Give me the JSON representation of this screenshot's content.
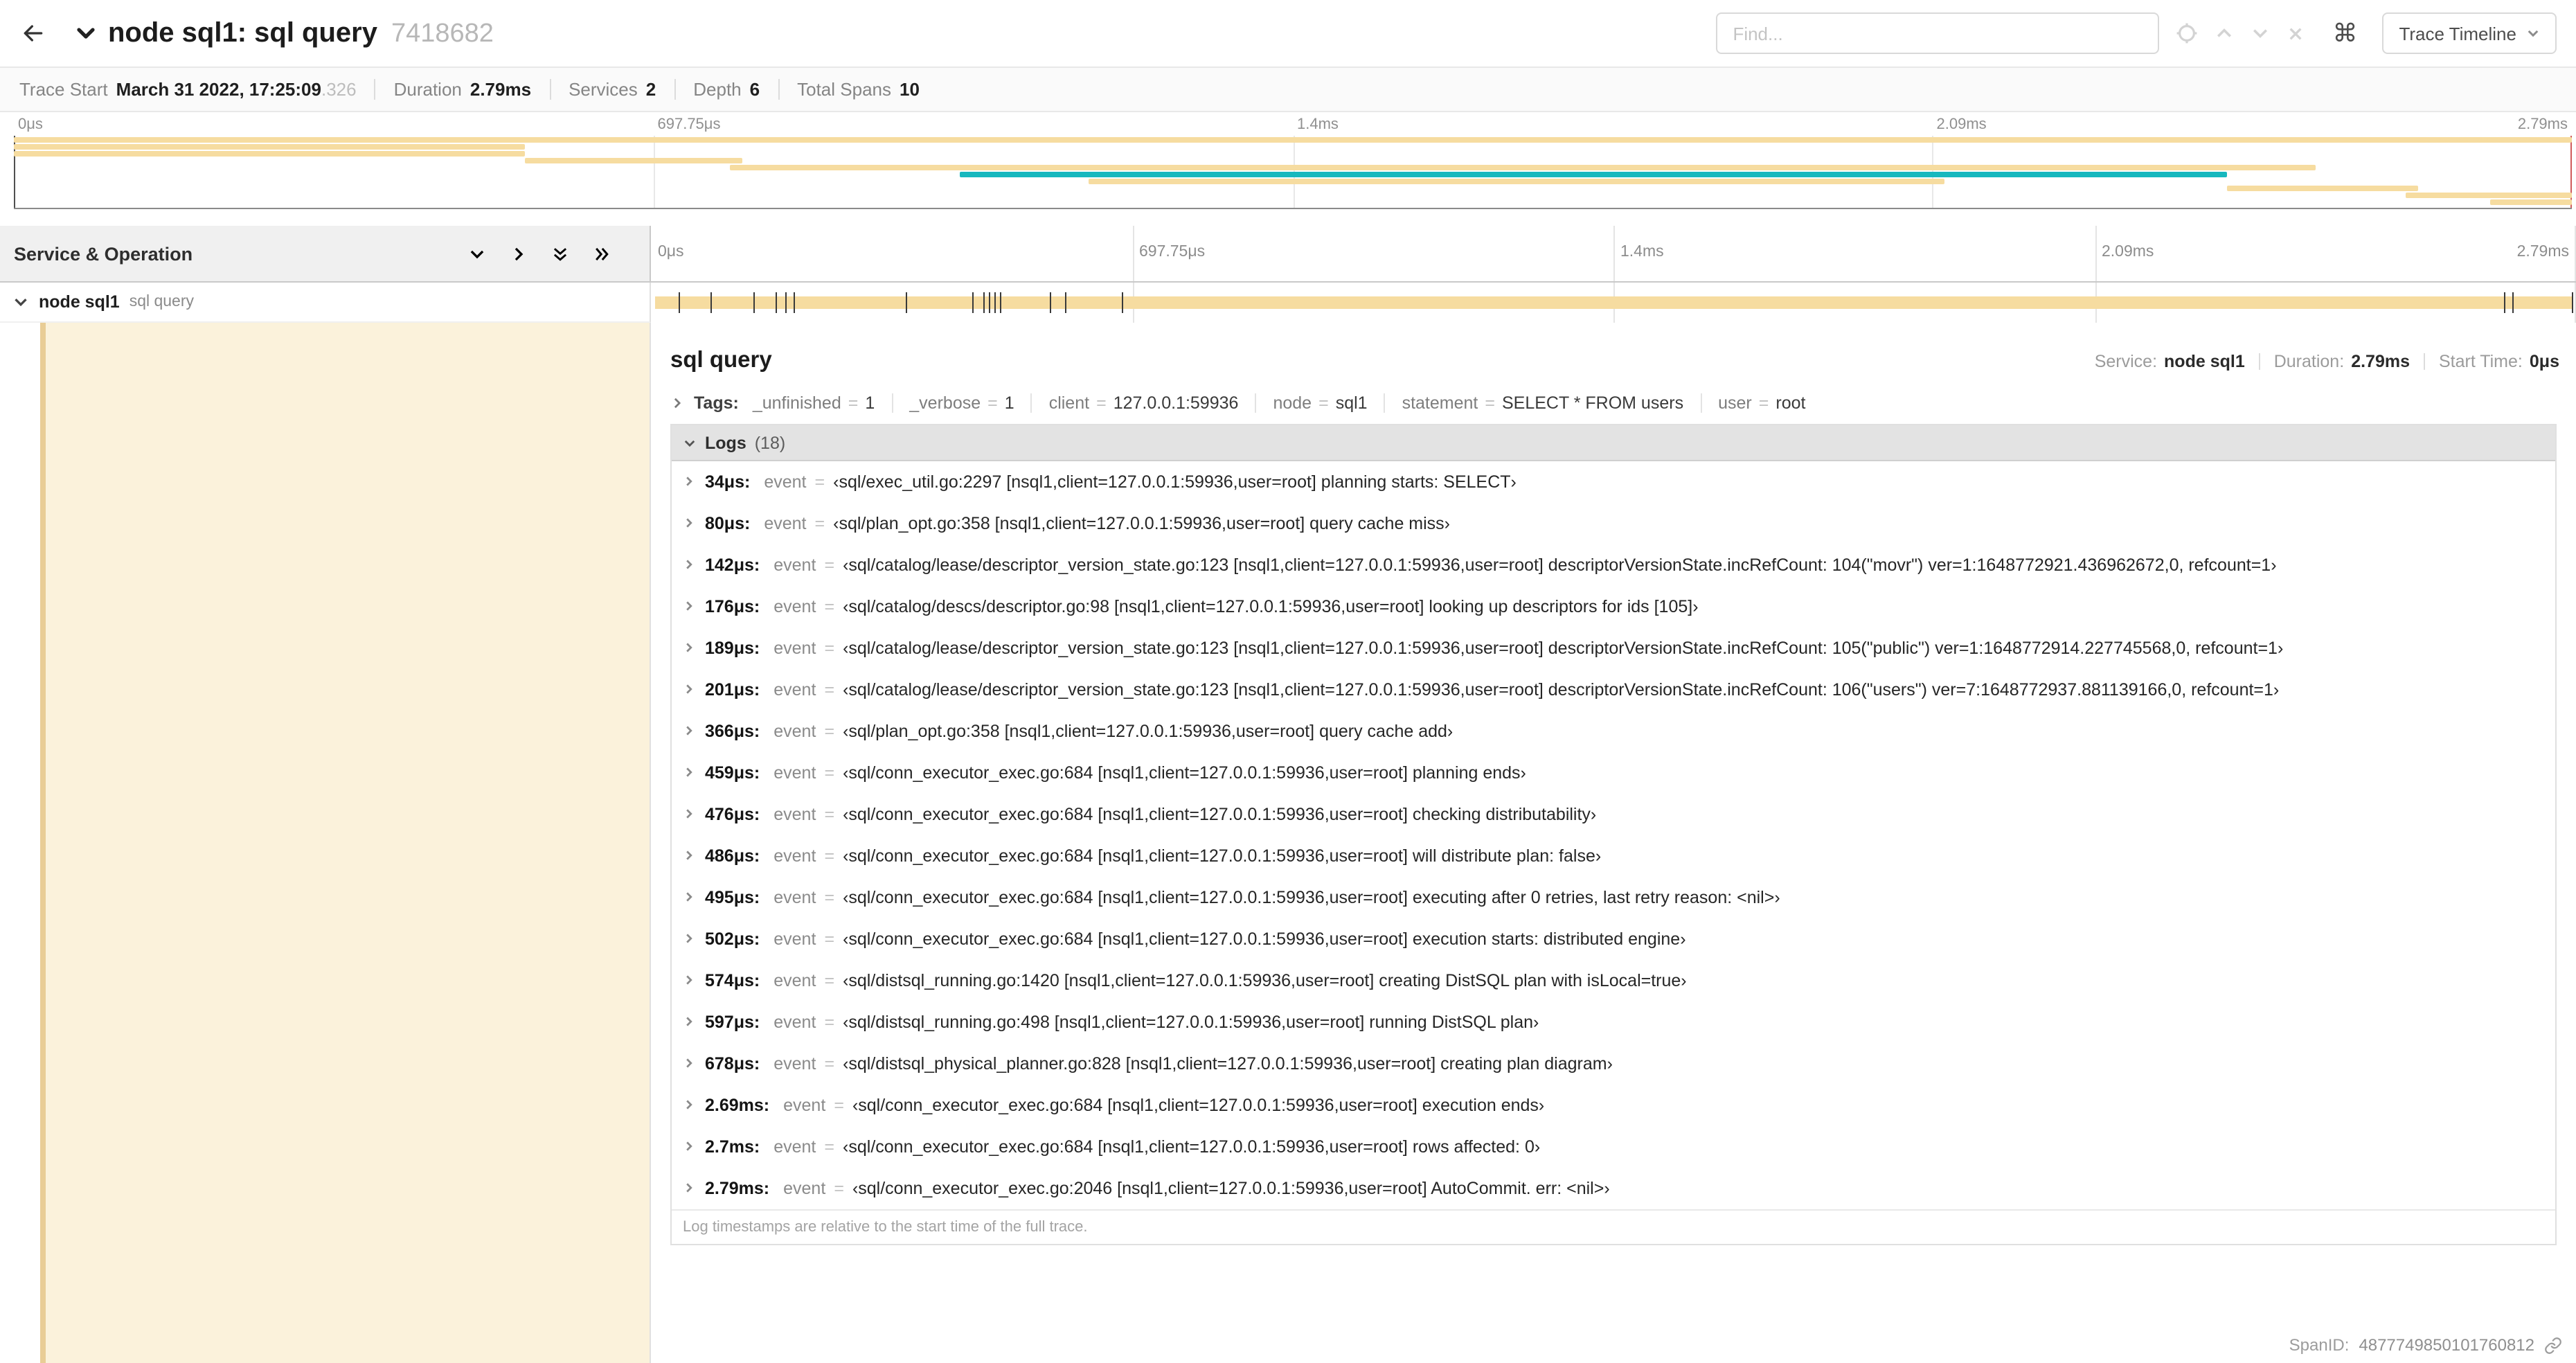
{
  "header": {
    "title": "node sql1: sql query",
    "trace_id": "7418682",
    "find_placeholder": "Find...",
    "shortcut_icon": "⌘",
    "view_button": "Trace Timeline"
  },
  "summary": {
    "items": [
      {
        "label": "Trace Start",
        "value": "March 31 2022, 17:25:09",
        "suffix": ".326"
      },
      {
        "label": "Duration",
        "value": "2.79ms"
      },
      {
        "label": "Services",
        "value": "2"
      },
      {
        "label": "Depth",
        "value": "6"
      },
      {
        "label": "Total Spans",
        "value": "10"
      }
    ]
  },
  "timeline": {
    "ticks": [
      {
        "label": "0μs",
        "pos": 0
      },
      {
        "label": "697.75μs",
        "pos": 25
      },
      {
        "label": "1.4ms",
        "pos": 50
      },
      {
        "label": "2.09ms",
        "pos": 75
      },
      {
        "label": "2.79ms",
        "pos": 100
      }
    ]
  },
  "minimap": {
    "colors": {
      "tan": "#F6DCA0",
      "teal": "#17B8BE"
    },
    "spans": [
      {
        "start": 0.0,
        "end": 1.0,
        "row": 0,
        "color": "tan"
      },
      {
        "start": 0.0,
        "end": 0.2,
        "row": 1,
        "color": "tan"
      },
      {
        "start": 0.0,
        "end": 0.2,
        "row": 2,
        "color": "tan"
      },
      {
        "start": 0.2,
        "end": 0.285,
        "row": 3,
        "color": "tan"
      },
      {
        "start": 0.28,
        "end": 0.9,
        "row": 4,
        "color": "tan"
      },
      {
        "start": 0.37,
        "end": 0.865,
        "row": 5,
        "color": "teal"
      },
      {
        "start": 0.42,
        "end": 0.755,
        "row": 6,
        "color": "tan"
      },
      {
        "start": 0.865,
        "end": 0.94,
        "row": 7,
        "color": "tan"
      },
      {
        "start": 0.935,
        "end": 1.0,
        "row": 8,
        "color": "tan"
      },
      {
        "start": 0.968,
        "end": 1.0,
        "row": 9,
        "color": "tan"
      }
    ]
  },
  "span_list": {
    "header": "Service & Operation",
    "row": {
      "service": "node sql1",
      "operation": "sql query"
    },
    "tick_fractions": [
      1.2,
      2.9,
      5.1,
      6.3,
      6.8,
      7.2,
      13.1,
      16.5,
      17.1,
      17.4,
      17.7,
      18.0,
      20.6,
      21.4,
      24.3,
      96.4,
      96.8,
      99.9
    ]
  },
  "detail": {
    "title": "sql query",
    "eq": "=",
    "meta": [
      {
        "label": "Service:",
        "value": "node sql1"
      },
      {
        "label": "Duration:",
        "value": "2.79ms"
      },
      {
        "label": "Start Time:",
        "value": "0μs"
      }
    ],
    "tags_label": "Tags:",
    "tags": [
      {
        "k": "_unfinished",
        "v": "1"
      },
      {
        "k": "_verbose",
        "v": "1"
      },
      {
        "k": "client",
        "v": "127.0.0.1:59936"
      },
      {
        "k": "node",
        "v": "sql1"
      },
      {
        "k": "statement",
        "v": "SELECT * FROM users"
      },
      {
        "k": "user",
        "v": "root"
      }
    ],
    "logs_label": "Logs",
    "logs_count": "(18)",
    "logs": [
      {
        "t": "34μs:",
        "k": "event",
        "v": "‹sql/exec_util.go:2297 [nsql1,client=127.0.0.1:59936,user=root] planning starts: SELECT›"
      },
      {
        "t": "80μs:",
        "k": "event",
        "v": "‹sql/plan_opt.go:358 [nsql1,client=127.0.0.1:59936,user=root] query cache miss›"
      },
      {
        "t": "142μs:",
        "k": "event",
        "v": "‹sql/catalog/lease/descriptor_version_state.go:123 [nsql1,client=127.0.0.1:59936,user=root] descriptorVersionState.incRefCount: 104(\"movr\") ver=1:1648772921.436962672,0, refcount=1›"
      },
      {
        "t": "176μs:",
        "k": "event",
        "v": "‹sql/catalog/descs/descriptor.go:98 [nsql1,client=127.0.0.1:59936,user=root] looking up descriptors for ids [105]›"
      },
      {
        "t": "189μs:",
        "k": "event",
        "v": "‹sql/catalog/lease/descriptor_version_state.go:123 [nsql1,client=127.0.0.1:59936,user=root] descriptorVersionState.incRefCount: 105(\"public\") ver=1:1648772914.227745568,0, refcount=1›"
      },
      {
        "t": "201μs:",
        "k": "event",
        "v": "‹sql/catalog/lease/descriptor_version_state.go:123 [nsql1,client=127.0.0.1:59936,user=root] descriptorVersionState.incRefCount: 106(\"users\") ver=7:1648772937.881139166,0, refcount=1›"
      },
      {
        "t": "366μs:",
        "k": "event",
        "v": "‹sql/plan_opt.go:358 [nsql1,client=127.0.0.1:59936,user=root] query cache add›"
      },
      {
        "t": "459μs:",
        "k": "event",
        "v": "‹sql/conn_executor_exec.go:684 [nsql1,client=127.0.0.1:59936,user=root] planning ends›"
      },
      {
        "t": "476μs:",
        "k": "event",
        "v": "‹sql/conn_executor_exec.go:684 [nsql1,client=127.0.0.1:59936,user=root] checking distributability›"
      },
      {
        "t": "486μs:",
        "k": "event",
        "v": "‹sql/conn_executor_exec.go:684 [nsql1,client=127.0.0.1:59936,user=root] will distribute plan: false›"
      },
      {
        "t": "495μs:",
        "k": "event",
        "v": "‹sql/conn_executor_exec.go:684 [nsql1,client=127.0.0.1:59936,user=root] executing after 0 retries, last retry reason: <nil>›"
      },
      {
        "t": "502μs:",
        "k": "event",
        "v": "‹sql/conn_executor_exec.go:684 [nsql1,client=127.0.0.1:59936,user=root] execution starts: distributed engine›"
      },
      {
        "t": "574μs:",
        "k": "event",
        "v": "‹sql/distsql_running.go:1420 [nsql1,client=127.0.0.1:59936,user=root] creating DistSQL plan with isLocal=true›"
      },
      {
        "t": "597μs:",
        "k": "event",
        "v": "‹sql/distsql_running.go:498 [nsql1,client=127.0.0.1:59936,user=root] running DistSQL plan›"
      },
      {
        "t": "678μs:",
        "k": "event",
        "v": "‹sql/distsql_physical_planner.go:828 [nsql1,client=127.0.0.1:59936,user=root] creating plan diagram›"
      },
      {
        "t": "2.69ms:",
        "k": "event",
        "v": "‹sql/conn_executor_exec.go:684 [nsql1,client=127.0.0.1:59936,user=root] execution ends›"
      },
      {
        "t": "2.7ms:",
        "k": "event",
        "v": "‹sql/conn_executor_exec.go:684 [nsql1,client=127.0.0.1:59936,user=root] rows affected: 0›"
      },
      {
        "t": "2.79ms:",
        "k": "event",
        "v": "‹sql/conn_executor_exec.go:2046 [nsql1,client=127.0.0.1:59936,user=root] AutoCommit. err: <nil>›"
      }
    ],
    "footer": "Log timestamps are relative to the start time of the full trace.",
    "spanid_label": "SpanID:",
    "spanid": "4877749850101760812"
  }
}
